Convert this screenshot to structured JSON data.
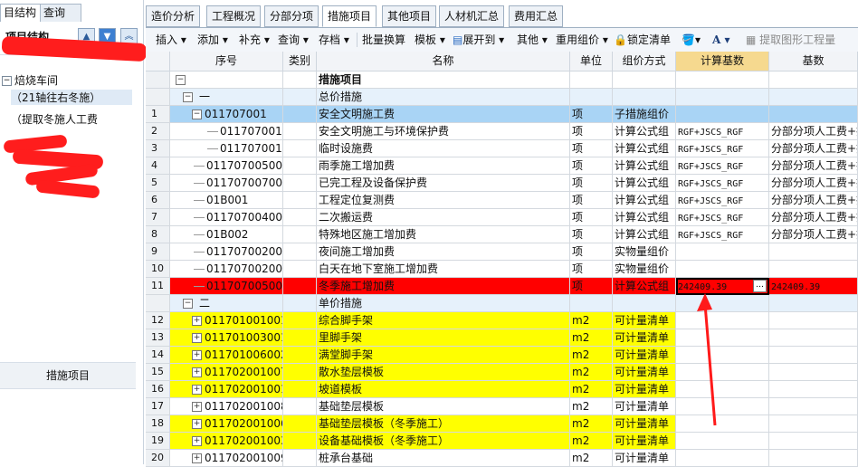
{
  "left_panel": {
    "tabs": [
      "目结构",
      "查询"
    ],
    "title": "项目结构",
    "tree": [
      "焙烧车间",
      "（21轴往右冬施）",
      "（提取冬施人工费"
    ],
    "bottom_button": "措施项目"
  },
  "main_tabs": [
    "造价分析",
    "工程概况",
    "分部分项",
    "措施项目",
    "其他项目",
    "人材机汇总",
    "费用汇总"
  ],
  "active_tab": "措施项目",
  "toolbar": {
    "insert": "插入",
    "add": "添加",
    "supplement": "补充",
    "query": "查询",
    "archive": "存档",
    "batch_convert": "批量换算",
    "template": "模板",
    "expand_to": "展开到",
    "other": "其他",
    "reuse_price": "重用组价",
    "lock_list": "锁定清单",
    "extract_quantity": "提取图形工程量"
  },
  "grid": {
    "headers": [
      "序号",
      "类别",
      "名称",
      "单位",
      "组价方式",
      "计算基数",
      "基数"
    ],
    "rows": [
      {
        "no": "",
        "code": "",
        "name": "措施项目",
        "unit": "",
        "method": "",
        "base": "",
        "desc": "",
        "style": "root"
      },
      {
        "no": "",
        "code": "一",
        "name": "总价措施",
        "unit": "",
        "method": "",
        "base": "",
        "desc": "",
        "style": "group"
      },
      {
        "no": "1",
        "code": "011707001",
        "name": "安全文明施工费",
        "unit": "项",
        "method": "子措施组价",
        "base": "",
        "desc": "",
        "style": "blue"
      },
      {
        "no": "2",
        "code": "01170700100",
        "name": "安全文明施工与环境保护费",
        "unit": "项",
        "method": "计算公式组",
        "base": "RGF+JSCS_RGF",
        "desc": "分部分项人工费+技",
        "style": "white"
      },
      {
        "no": "3",
        "code": "01170700100",
        "name": "临时设施费",
        "unit": "项",
        "method": "计算公式组",
        "base": "RGF+JSCS_RGF",
        "desc": "分部分项人工费+技",
        "style": "white"
      },
      {
        "no": "4",
        "code": "011707005001",
        "name": "雨季施工增加费",
        "unit": "项",
        "method": "计算公式组",
        "base": "RGF+JSCS_RGF",
        "desc": "分部分项人工费+技",
        "style": "white"
      },
      {
        "no": "5",
        "code": "011707007001",
        "name": "已完工程及设备保护费",
        "unit": "项",
        "method": "计算公式组",
        "base": "RGF+JSCS_RGF",
        "desc": "分部分项人工费+技",
        "style": "white"
      },
      {
        "no": "6",
        "code": "01B001",
        "name": "工程定位复测费",
        "unit": "项",
        "method": "计算公式组",
        "base": "RGF+JSCS_RGF",
        "desc": "分部分项人工费+技",
        "style": "white"
      },
      {
        "no": "7",
        "code": "011707004001",
        "name": "二次搬运费",
        "unit": "项",
        "method": "计算公式组",
        "base": "RGF+JSCS_RGF",
        "desc": "分部分项人工费+技",
        "style": "white"
      },
      {
        "no": "8",
        "code": "01B002",
        "name": "特殊地区施工增加费",
        "unit": "项",
        "method": "计算公式组",
        "base": "RGF+JSCS_RGF",
        "desc": "分部分项人工费+技",
        "style": "white"
      },
      {
        "no": "9",
        "code": "011707002001",
        "name": "夜间施工增加费",
        "unit": "项",
        "method": "实物量组价",
        "base": "",
        "desc": "",
        "style": "white"
      },
      {
        "no": "10",
        "code": "011707002002",
        "name": "白天在地下室施工增加费",
        "unit": "项",
        "method": "实物量组价",
        "base": "",
        "desc": "",
        "style": "white"
      },
      {
        "no": "11",
        "code": "011707005002",
        "name": "冬季施工增加费",
        "unit": "项",
        "method": "计算公式组",
        "base": "242409.39",
        "desc": "242409.39",
        "style": "red"
      },
      {
        "no": "",
        "code": "二",
        "name": "单价措施",
        "unit": "",
        "method": "",
        "base": "",
        "desc": "",
        "style": "group"
      },
      {
        "no": "12",
        "code": "011701001001",
        "name": "综合脚手架",
        "unit": "m2",
        "method": "可计量清单",
        "base": "",
        "desc": "",
        "style": "yellow"
      },
      {
        "no": "13",
        "code": "011701003001",
        "name": "里脚手架",
        "unit": "m2",
        "method": "可计量清单",
        "base": "",
        "desc": "",
        "style": "yellow"
      },
      {
        "no": "14",
        "code": "011701006002",
        "name": "满堂脚手架",
        "unit": "m2",
        "method": "可计量清单",
        "base": "",
        "desc": "",
        "style": "yellow"
      },
      {
        "no": "15",
        "code": "011702001007",
        "name": "散水垫层模板",
        "unit": "m2",
        "method": "可计量清单",
        "base": "",
        "desc": "",
        "style": "yellow"
      },
      {
        "no": "16",
        "code": "011702001001",
        "name": "坡道模板",
        "unit": "m2",
        "method": "可计量清单",
        "base": "",
        "desc": "",
        "style": "yellow"
      },
      {
        "no": "17",
        "code": "011702001008",
        "name": "基础垫层模板",
        "unit": "m2",
        "method": "可计量清单",
        "base": "",
        "desc": "",
        "style": "white"
      },
      {
        "no": "18",
        "code": "011702001006",
        "name": "基础垫层模板（冬季施工）",
        "unit": "m2",
        "method": "可计量清单",
        "base": "",
        "desc": "",
        "style": "yellow"
      },
      {
        "no": "19",
        "code": "011702001003",
        "name": "设备基础模板（冬季施工）",
        "unit": "m2",
        "method": "可计量清单",
        "base": "",
        "desc": "",
        "style": "yellow"
      },
      {
        "no": "20",
        "code": "011702001009",
        "name": "桩承台基础",
        "unit": "m2",
        "method": "可计量清单",
        "base": "",
        "desc": "",
        "style": "white"
      }
    ]
  },
  "colors": {
    "blue_row": "#a9d4f5",
    "red_row": "#ff0000",
    "yellow_row": "#ffff00",
    "group_row": "#e6f1fb",
    "header_highlight": "#f6d98f",
    "arrow": "#ff1a1a"
  }
}
